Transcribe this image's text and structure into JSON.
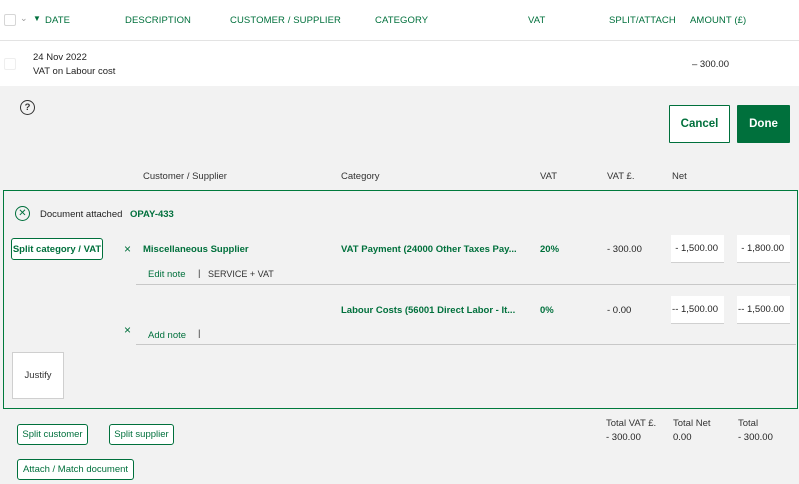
{
  "table_header": {
    "date": "DATE",
    "description": "DESCRIPTION",
    "customer_supplier": "CUSTOMER / SUPPLIER",
    "category": "CATEGORY",
    "vat": "VAT",
    "split_attach": "SPLIT/ATTACH",
    "amount": "AMOUNT (£)"
  },
  "transaction": {
    "date": "24 Nov 2022",
    "description": "VAT on Labour cost",
    "amount": "– 300.00"
  },
  "actions": {
    "help_icon": "?",
    "cancel": "Cancel",
    "done": "Done"
  },
  "split_header": {
    "customer_supplier": "Customer / Supplier",
    "category": "Category",
    "vat": "VAT",
    "vat_amount": "VAT £.",
    "net": "Net"
  },
  "document": {
    "label": "Document attached",
    "ref": "OPAY-433"
  },
  "split_category_button": "Split category / VAT",
  "lines": [
    {
      "supplier": "Miscellaneous Supplier",
      "category": "VAT Payment (24000 Other Taxes Pay...",
      "vat": "20%",
      "vat_amount": "- 300.00",
      "net": "- 1,500.00",
      "total": "- 1,800.00",
      "note_link": "Edit note",
      "note_text": "SERVICE + VAT"
    },
    {
      "supplier": "",
      "category": "Labour Costs (56001 Direct Labor - It...",
      "vat": "0%",
      "vat_amount": "- 0.00",
      "net": "-- 1,500.00",
      "total": "-- 1,500.00",
      "note_link": "Add note",
      "note_text": ""
    }
  ],
  "justify_button": "Justify",
  "footer": {
    "split_customer": "Split customer",
    "split_supplier": "Split supplier",
    "attach_match": "Attach / Match document",
    "total_vat_label": "Total VAT £.",
    "total_vat_value": "- 300.00",
    "total_net_label": "Total Net",
    "total_net_value": "0.00",
    "total_label": "Total",
    "total_value": "- 300.00"
  },
  "colors": {
    "brand_green": "#00703c",
    "panel_grey": "#f2f2f2"
  }
}
